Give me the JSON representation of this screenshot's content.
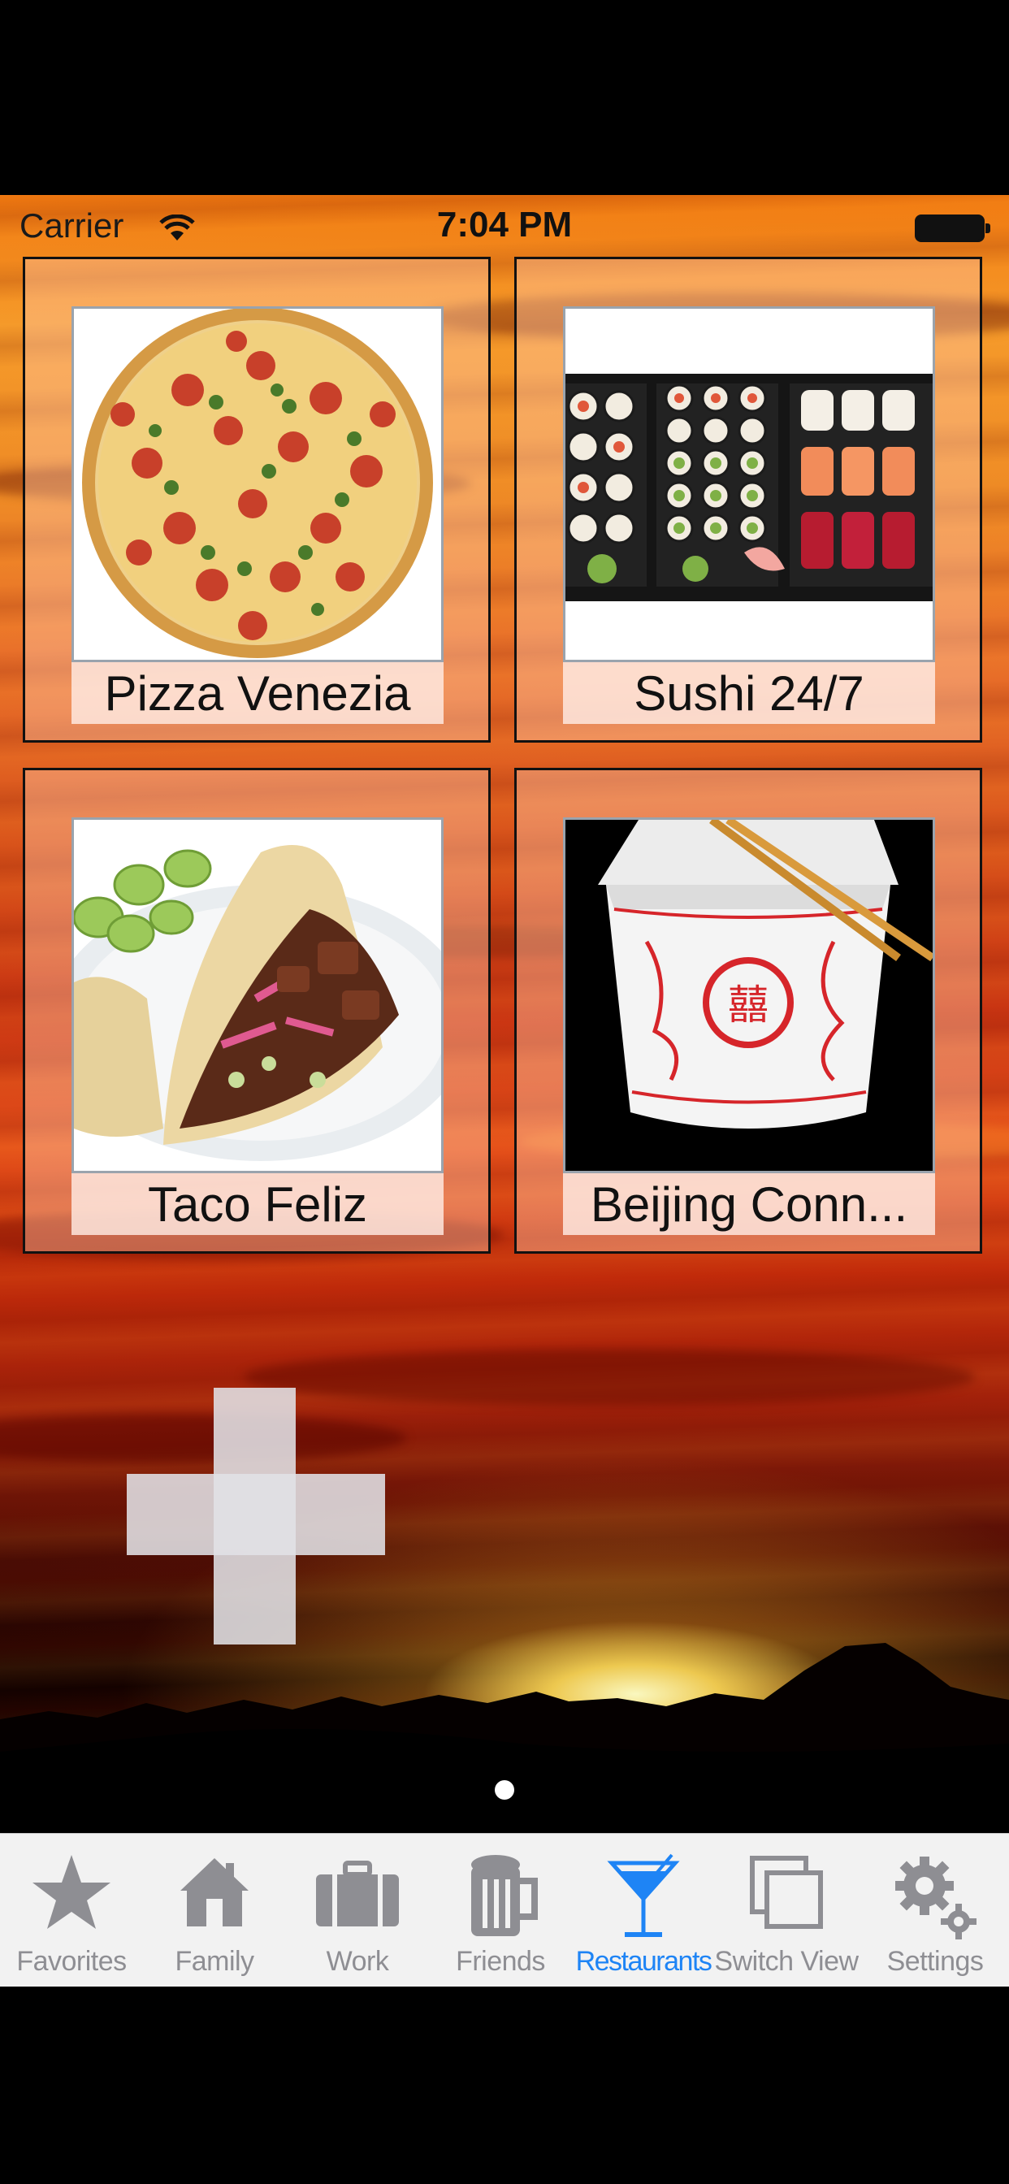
{
  "status_bar": {
    "carrier": "Carrier",
    "time": "7:04 PM"
  },
  "tiles": [
    {
      "label": "Pizza Venezia",
      "image": "pizza-image"
    },
    {
      "label": "Sushi 24/7",
      "image": "sushi-image"
    },
    {
      "label": "Taco Feliz",
      "image": "taco-image"
    },
    {
      "label": "Beijing Conn...",
      "image": "chinese-takeout-image"
    }
  ],
  "add_button": {
    "icon": "plus-icon"
  },
  "page_indicator": {
    "pages": 1,
    "current": 1
  },
  "tabbar": {
    "items": [
      {
        "label": "Favorites",
        "icon": "star-icon",
        "active": false
      },
      {
        "label": "Family",
        "icon": "house-icon",
        "active": false
      },
      {
        "label": "Work",
        "icon": "briefcase-icon",
        "active": false
      },
      {
        "label": "Friends",
        "icon": "beer-mug-icon",
        "active": false
      },
      {
        "label": "Restaurants",
        "icon": "cocktail-glass-icon",
        "active": true
      },
      {
        "label": "Switch View",
        "icon": "switch-view-icon",
        "active": false
      },
      {
        "label": "Settings",
        "icon": "gear-icon",
        "active": false
      }
    ],
    "active_color": "#1e84f5",
    "inactive_color": "#8e8e93"
  }
}
